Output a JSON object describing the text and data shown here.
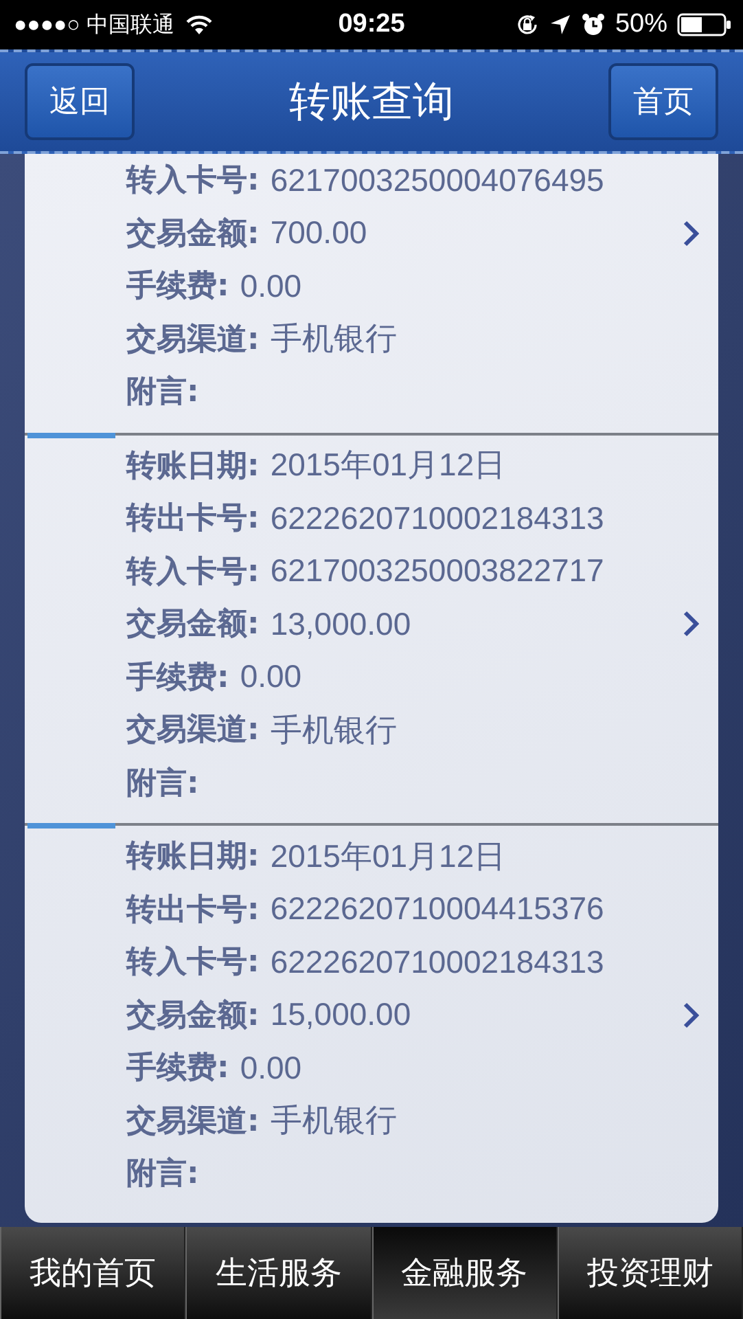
{
  "status_bar": {
    "carrier": "●●●●○ 中国联通",
    "time": "09:25",
    "battery": "50%"
  },
  "header": {
    "back_button": "返回",
    "title": "转账查询",
    "home_button": "首页"
  },
  "records": [
    {
      "fields": [
        {
          "label": "转入卡号:",
          "value": "6217003250004076495"
        },
        {
          "label": "交易金额:",
          "value": "700.00"
        },
        {
          "label": "手续费:",
          "value": "0.00"
        },
        {
          "label": "交易渠道:",
          "value": "手机银行"
        },
        {
          "label": "附言:"
        }
      ]
    },
    {
      "fields": [
        {
          "label": "转账日期:",
          "value": "2015年01月12日"
        },
        {
          "label": "转出卡号:",
          "value": "6222620710002184313"
        },
        {
          "label": "转入卡号:",
          "value": "6217003250003822717"
        },
        {
          "label": "交易金额:",
          "value": "13,000.00"
        },
        {
          "label": "手续费:",
          "value": "0.00"
        },
        {
          "label": "交易渠道:",
          "value": "手机银行"
        },
        {
          "label": "附言:"
        }
      ]
    },
    {
      "fields": [
        {
          "label": "转账日期:",
          "value": "2015年01月12日"
        },
        {
          "label": "转出卡号:",
          "value": "6222620710004415376"
        },
        {
          "label": "转入卡号:",
          "value": "6222620710002184313"
        },
        {
          "label": "交易金额:",
          "value": "15,000.00"
        },
        {
          "label": "手续费:",
          "value": "0.00"
        },
        {
          "label": "交易渠道:",
          "value": "手机银行"
        },
        {
          "label": "附言:"
        }
      ]
    }
  ],
  "tabs": [
    {
      "label": "我的首页",
      "selected": false
    },
    {
      "label": "生活服务",
      "selected": false
    },
    {
      "label": "金融服务",
      "selected": true
    },
    {
      "label": "投资理财",
      "selected": false
    }
  ]
}
